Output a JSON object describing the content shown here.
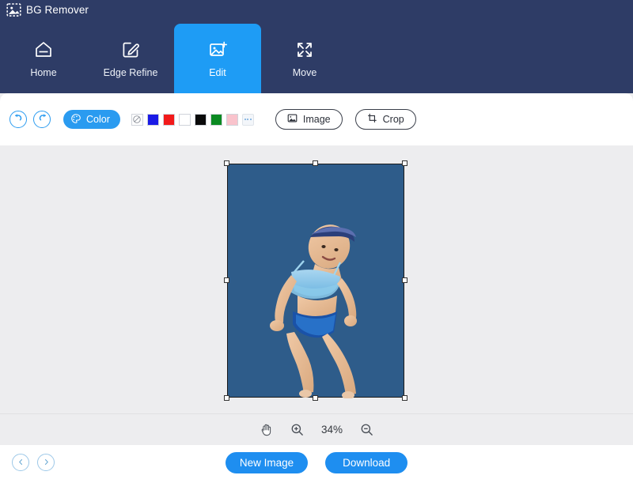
{
  "app": {
    "title": "BG Remover",
    "logo_icon": "image-dashed-icon",
    "header_color": "#2e3c66",
    "accent_color": "#1e9cf5"
  },
  "tabs": [
    {
      "label": "Home",
      "icon": "home-icon",
      "active": false
    },
    {
      "label": "Edge Refine",
      "icon": "pencil-square-icon",
      "active": false
    },
    {
      "label": "Edit",
      "icon": "image-edit-icon",
      "active": true
    },
    {
      "label": "Move",
      "icon": "move-arrows-icon",
      "active": false
    }
  ],
  "toolbar": {
    "undo_icon": "undo-arrow-icon",
    "redo_icon": "redo-arrow-icon",
    "color_button": {
      "label": "Color",
      "icon": "palette-icon"
    },
    "swatches": [
      {
        "name": "none",
        "color": "#ffffff"
      },
      {
        "name": "blue",
        "color": "#1a1ae6"
      },
      {
        "name": "red",
        "color": "#f21a1a"
      },
      {
        "name": "white",
        "color": "#ffffff"
      },
      {
        "name": "black",
        "color": "#0a0a0a"
      },
      {
        "name": "green",
        "color": "#0b8a22"
      },
      {
        "name": "pink",
        "color": "#f9c3cc"
      }
    ],
    "more_swatches_label": "",
    "image_button": {
      "label": "Image",
      "icon": "picture-icon"
    },
    "crop_button": {
      "label": "Crop",
      "icon": "crop-square-icon"
    }
  },
  "canvas": {
    "background_color": "#2e5c8a",
    "subject_alt": "child-in-swimsuit-cutout",
    "selected": true
  },
  "zoombar": {
    "hand_icon": "hand-tool-icon",
    "zoom_in_icon": "zoom-in-icon",
    "zoom_out_icon": "zoom-out-icon",
    "zoom_level": "34%"
  },
  "bottombar": {
    "prev_icon": "chevron-left-icon",
    "next_icon": "chevron-right-icon",
    "new_image_label": "New Image",
    "download_label": "Download"
  }
}
